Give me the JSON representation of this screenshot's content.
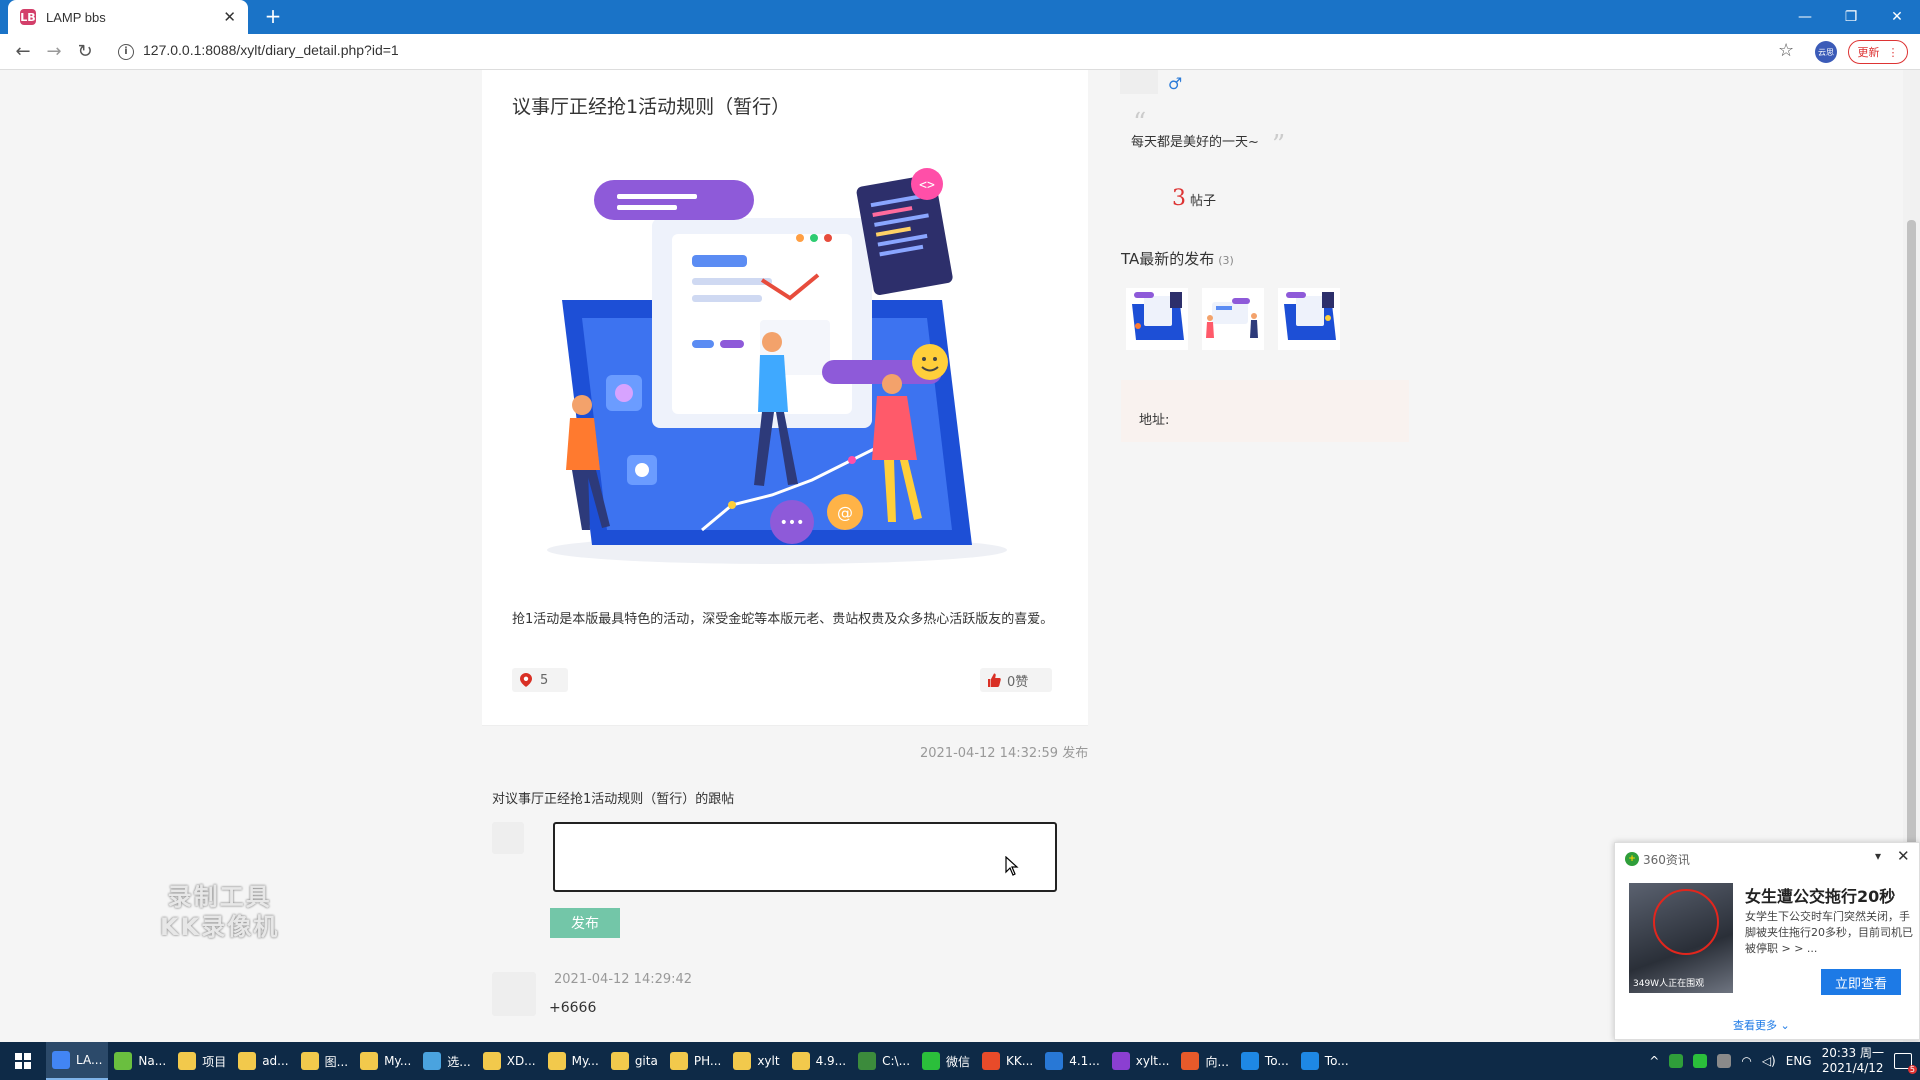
{
  "browser": {
    "tab_title": "LAMP bbs",
    "tab_favicon": "LB",
    "tab_close": "✕",
    "new_tab": "+",
    "url": "127.0.0.1:8088/xylt/diary_detail.php?id=1",
    "update_label": "更新",
    "profile_label": "云思",
    "window_controls": [
      "—",
      "❐",
      "✕"
    ]
  },
  "post": {
    "title": "议事厅正经抢1活动规则（暂行）",
    "description": "抢1活动是本版最具特色的活动，深受金蛇等本版元老、贵站权贵及众多热心活跃版友的喜爱。",
    "location_count": "5",
    "likes_label": "0赞",
    "published": "2021-04-12 14:32:59 发布"
  },
  "reply": {
    "heading": "对议事厅正经抢1活动规则（暂行）的跟帖",
    "input_value": "",
    "publish_label": "发布"
  },
  "comments": [
    {
      "time": "2021-04-12 14:29:42",
      "text": "+6666"
    }
  ],
  "author": {
    "gender_icon": "male-icon",
    "motto": "每天都是美好的一天~",
    "quote_open": "“",
    "quote_close": "”",
    "post_count": "3",
    "post_count_label": "帖子",
    "recent_title": "TA最新的发布",
    "recent_count": "(3)",
    "address_label": "地址:"
  },
  "watermark": {
    "line1": "录制工具",
    "line2": "KK录像机"
  },
  "popup": {
    "source": "360资讯",
    "headline": "女生遭公交拖行20秒",
    "summary": "女学生下公交时车门突然关闭，手脚被夹住拖行20多秒，目前司机已被停职 > > ...",
    "image_caption": "349W人正在围观",
    "cta_label": "立即查看",
    "more_label": "查看更多 ⌄",
    "collapse": "▾",
    "close": "✕"
  },
  "taskbar": {
    "items": [
      {
        "label": "LA...",
        "color": "#4285f4"
      },
      {
        "label": "Na...",
        "color": "#6abf3f"
      },
      {
        "label": "项目",
        "color": "#f2c94c"
      },
      {
        "label": "ad...",
        "color": "#f2c94c"
      },
      {
        "label": "图...",
        "color": "#f2c94c"
      },
      {
        "label": "My...",
        "color": "#f2c94c"
      },
      {
        "label": "选...",
        "color": "#4aa3df"
      },
      {
        "label": "XD...",
        "color": "#f2c94c"
      },
      {
        "label": "My...",
        "color": "#f2c94c"
      },
      {
        "label": "gita",
        "color": "#f2c94c"
      },
      {
        "label": "PH...",
        "color": "#f2c94c"
      },
      {
        "label": "xylt",
        "color": "#f2c94c"
      },
      {
        "label": "4.9...",
        "color": "#f2c94c"
      },
      {
        "label": "C:\\...",
        "color": "#3c8b3c"
      },
      {
        "label": "微信",
        "color": "#2bbf3b"
      },
      {
        "label": "KK...",
        "color": "#e84b2a"
      },
      {
        "label": "4.1...",
        "color": "#2878d6"
      },
      {
        "label": "xylt...",
        "color": "#8b3fd1"
      },
      {
        "label": "向...",
        "color": "#e85a2a"
      },
      {
        "label": "To...",
        "color": "#1e88e5"
      },
      {
        "label": "To...",
        "color": "#1e88e5"
      }
    ],
    "lang": "ENG",
    "time": "20:33 周一",
    "date": "2021/4/12",
    "notifications": "5"
  }
}
